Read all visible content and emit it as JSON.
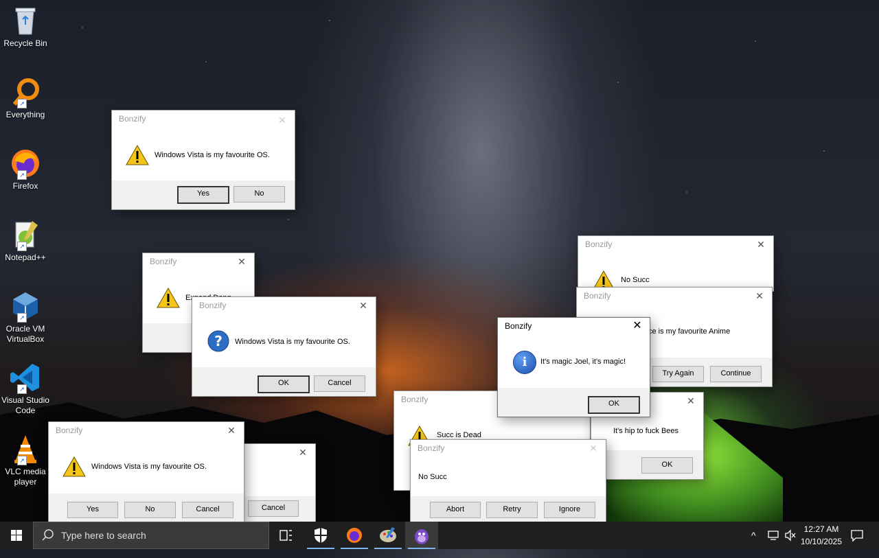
{
  "desktop": {
    "icons": [
      {
        "label": "Recycle Bin",
        "icon": "recycle-bin-icon"
      },
      {
        "label": "Everything",
        "icon": "everything-search-icon"
      },
      {
        "label": "Firefox",
        "icon": "firefox-icon"
      },
      {
        "label": "Notepad++",
        "icon": "notepad-plus-plus-icon"
      },
      {
        "label": "Oracle VM VirtualBox",
        "icon": "virtualbox-icon"
      },
      {
        "label": "Visual Studio Code",
        "icon": "vscode-icon"
      },
      {
        "label": "VLC media player",
        "icon": "vlc-icon"
      }
    ]
  },
  "dialogs": {
    "d1": {
      "title": "Bonzify",
      "message": "Windows Vista is my favourite OS.",
      "buttons": [
        "Yes",
        "No"
      ]
    },
    "d2": {
      "title": "Bonzify",
      "message": "Expand Dong"
    },
    "d3": {
      "title": "Bonzify",
      "message": "Windows Vista is my favourite OS.",
      "buttons": [
        "OK",
        "Cancel"
      ]
    },
    "d4": {
      "title": "Bonzify",
      "message": "Windows Vista is my favourite OS.",
      "buttons": [
        "Yes",
        "No",
        "Cancel"
      ]
    },
    "d5": {
      "buttons": [
        "Cancel"
      ]
    },
    "d6": {
      "title": "Bonzify",
      "message": "No Succ"
    },
    "d7": {
      "title": "Bonzify",
      "message": "ce is my favourite Anime",
      "buttons": [
        "Try Again",
        "Continue"
      ]
    },
    "d8": {
      "title": "Bonzify",
      "message": "It's magic Joel, it's magic!",
      "buttons": [
        "OK"
      ]
    },
    "d9": {
      "title": "Bonzify",
      "message": "Succ is Dead"
    },
    "d10": {
      "message": "It's hip to fuck Bees",
      "buttons": [
        "OK"
      ]
    },
    "d11": {
      "title": "Bonzify",
      "message": "No Succ",
      "buttons": [
        "Abort",
        "Retry",
        "Ignore"
      ]
    }
  },
  "taskbar": {
    "search_placeholder": "Type here to search",
    "time": "12:27 AM",
    "date": "10/10/2025",
    "pinned": [
      "task-view-icon",
      "windows-security-icon",
      "firefox-icon",
      "paint-icon",
      "bonzi-buddy-icon"
    ],
    "colors": {
      "accent": "#7eb6f0",
      "background": "#1f1f1f"
    }
  }
}
